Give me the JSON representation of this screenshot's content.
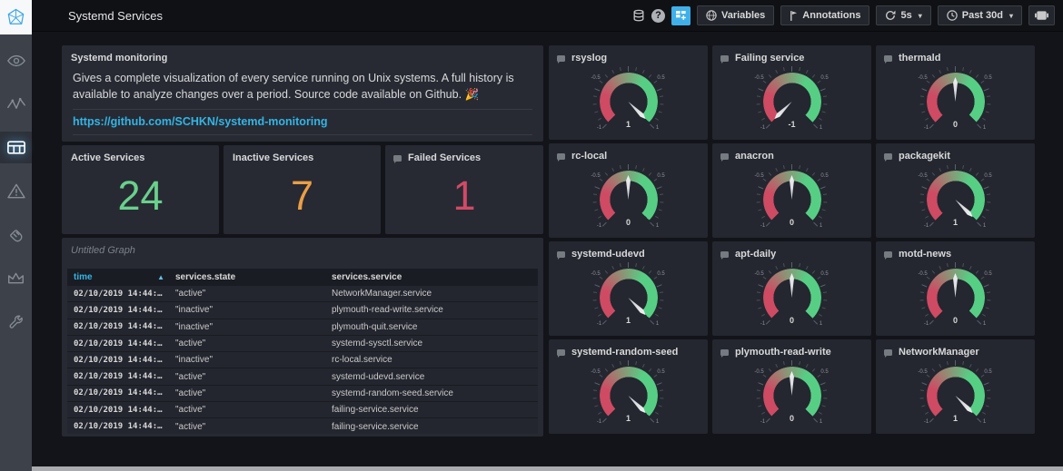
{
  "header": {
    "title": "Systemd Services",
    "toolbar": {
      "variables_label": "Variables",
      "annotations_label": "Annotations",
      "refresh_interval": "5s",
      "time_range": "Past 30d"
    }
  },
  "sidebar": {
    "icons": [
      "eye",
      "activity",
      "dashboard-grid",
      "alert-triangle",
      "hand",
      "crown",
      "wrench"
    ],
    "active_icon": "dashboard-grid"
  },
  "colors": {
    "accent": "#33b5e5",
    "active_green": "#69d08c",
    "inactive_orange": "#eb9f44",
    "failed_red": "#d24a66"
  },
  "panels": {
    "text_panel": {
      "title": "Systemd monitoring",
      "body": "Gives a complete visualization of every service running on Unix systems. A full history is available to analyze changes over a period. Source code available on Github. 🎉",
      "link": "https://github.com/SCHKN/systemd-monitoring"
    },
    "stats": [
      {
        "title": "Active Services",
        "value": "24",
        "color": "#69d08c"
      },
      {
        "title": "Inactive Services",
        "value": "7",
        "color": "#eb9f44"
      },
      {
        "title": "Failed Services",
        "value": "1",
        "color": "#d24a66"
      }
    ],
    "table": {
      "title": "Untitled Graph",
      "columns": [
        "time",
        "services.state",
        "services.service"
      ],
      "sort": {
        "column": "time",
        "direction": "asc"
      },
      "rows": [
        [
          "02/10/2019 14:44:…",
          "\"active\"",
          "NetworkManager.service"
        ],
        [
          "02/10/2019 14:44:…",
          "\"inactive\"",
          "plymouth-read-write.service"
        ],
        [
          "02/10/2019 14:44:…",
          "\"inactive\"",
          "plymouth-quit.service"
        ],
        [
          "02/10/2019 14:44:…",
          "\"active\"",
          "systemd-sysctl.service"
        ],
        [
          "02/10/2019 14:44:…",
          "\"inactive\"",
          "rc-local.service"
        ],
        [
          "02/10/2019 14:44:…",
          "\"active\"",
          "systemd-udevd.service"
        ],
        [
          "02/10/2019 14:44:…",
          "\"active\"",
          "systemd-random-seed.service"
        ],
        [
          "02/10/2019 14:44:…",
          "\"active\"",
          "failing-service.service"
        ],
        [
          "02/10/2019 14:44:…",
          "\"active\"",
          "failing-service.service"
        ]
      ]
    },
    "gauges": {
      "scale": {
        "min": "-1",
        "max": "1",
        "threshold_low": "-0.5",
        "threshold_high": "0.5"
      },
      "colors": {
        "low": "#cf4a63",
        "high": "#56cf85"
      },
      "items": [
        {
          "title": "rsyslog",
          "value": 1
        },
        {
          "title": "Failing service",
          "value": -1
        },
        {
          "title": "thermald",
          "value": 0
        },
        {
          "title": "rc-local",
          "value": 0
        },
        {
          "title": "anacron",
          "value": 0
        },
        {
          "title": "packagekit",
          "value": 1
        },
        {
          "title": "systemd-udevd",
          "value": 1
        },
        {
          "title": "apt-daily",
          "value": 0
        },
        {
          "title": "motd-news",
          "value": 0
        },
        {
          "title": "systemd-random-seed",
          "value": 1
        },
        {
          "title": "plymouth-read-write",
          "value": 0
        },
        {
          "title": "NetworkManager",
          "value": 1
        }
      ]
    }
  }
}
